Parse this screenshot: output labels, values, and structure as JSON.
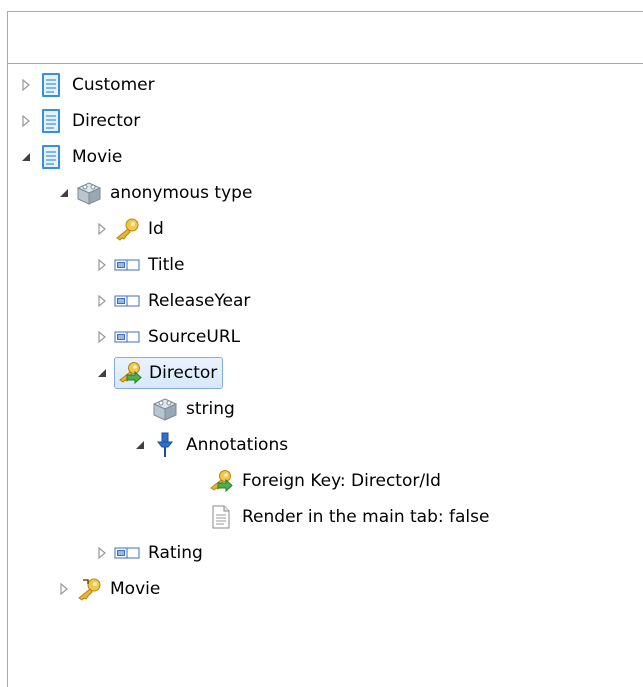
{
  "tree": {
    "customer": "Customer",
    "director": "Director",
    "movie": "Movie",
    "anonymous_type": "anonymous type",
    "id": "Id",
    "title": "Title",
    "release_year": "ReleaseYear",
    "source_url": "SourceURL",
    "director_ref": "Director",
    "string": "string",
    "annotations": "Annotations",
    "foreign_key": "Foreign Key:  Director/Id",
    "render_main_tab": "Render in the main tab: false",
    "rating": "Rating",
    "movie_key": "Movie"
  },
  "icons": {
    "entity": "document-icon",
    "type": "cube-icon",
    "key": "key-icon",
    "field": "field-icon",
    "foreign_key": "foreign-key-icon",
    "annotations": "pin-icon",
    "annotation_text": "note-icon"
  },
  "colors": {
    "selection_border": "#84acdd",
    "selection_fill": "#d7e8fb"
  }
}
